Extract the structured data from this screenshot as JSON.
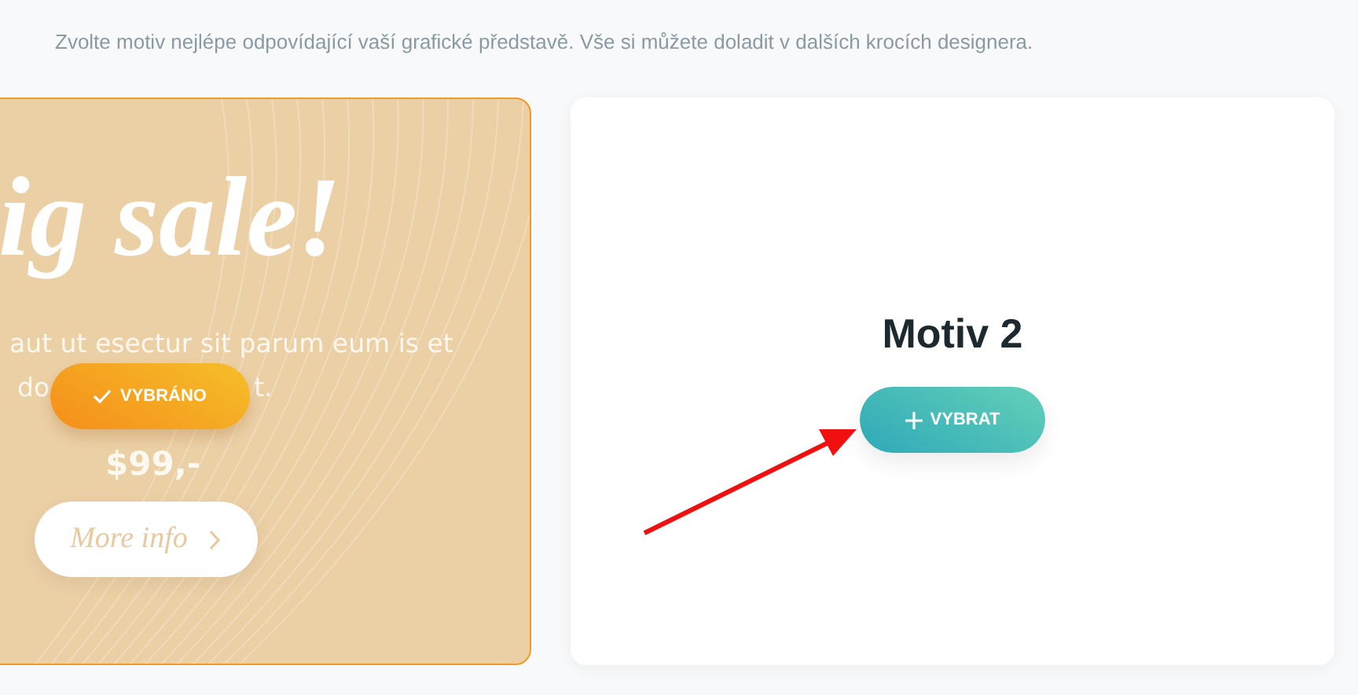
{
  "intro": "Zvolte motiv nejlépe odpovídající vaší grafické představě. Vše si můžete doladit v dalších krocích designera.",
  "motifs": [
    {
      "kind": "preview",
      "selected": true,
      "headline": "ig sale!",
      "text_line_1": "aut ut esectur sit parum eum is et",
      "text_line_2_start": "do",
      "text_line_2_end": "t.",
      "price": "$99,-",
      "link_button": "More info",
      "button": "VYBRÁNO"
    },
    {
      "kind": "title",
      "selected": false,
      "title": "Motiv 2",
      "button": "VYBRAT"
    }
  ]
}
